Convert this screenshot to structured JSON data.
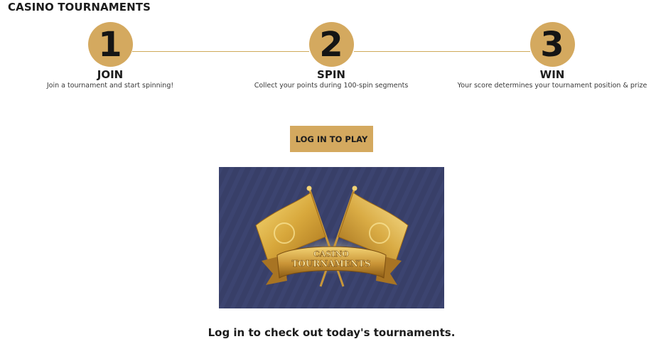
{
  "page": {
    "title": "CASINO TOURNAMENTS"
  },
  "steps": [
    {
      "number": "1",
      "title": "JOIN",
      "description": "Join a tournament and start spinning!"
    },
    {
      "number": "2",
      "title": "SPIN",
      "description": "Collect your points during 100-spin segments"
    },
    {
      "number": "3",
      "title": "WIN",
      "description": "Your score determines your tournament position & prize"
    }
  ],
  "login_button": {
    "label": "LOG IN TO PLAY"
  },
  "banner": {
    "line1": "CASINO",
    "line2": "TOURNAMENTS",
    "background_color": "#383f68",
    "gold_color": "#d4a95f"
  },
  "bottom_message": "Log in to check out today's tournaments.",
  "colors": {
    "accent_gold": "#d4a95f",
    "text": "#1c1c1c"
  }
}
